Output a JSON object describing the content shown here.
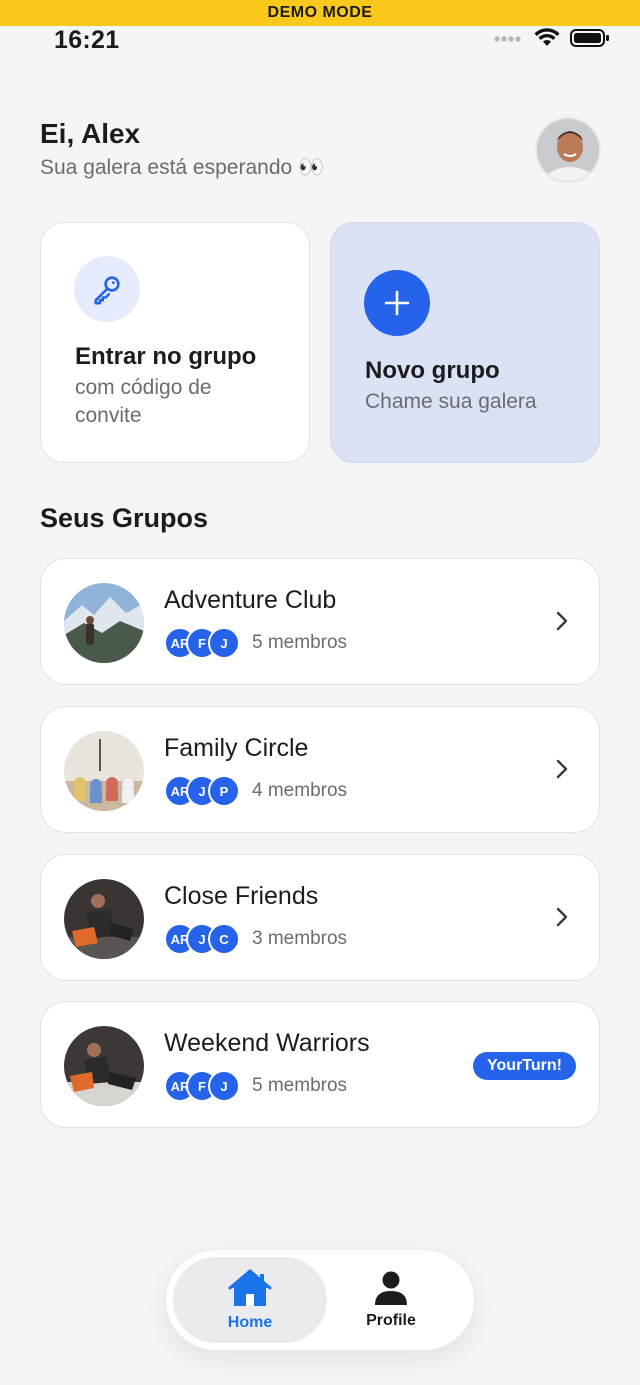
{
  "demo_banner": "DEMO MODE",
  "status_bar": {
    "time": "16:21"
  },
  "header": {
    "greeting": "Ei, Alex",
    "subtitle": "Sua galera está esperando 👀"
  },
  "actions": {
    "join": {
      "title": "Entrar no grupo",
      "subtitle_line1": "com código de",
      "subtitle_line2": "convite",
      "icon": "key-icon"
    },
    "new": {
      "title": "Novo grupo",
      "subtitle": "Chame sua galera",
      "icon": "plus-icon"
    }
  },
  "groups_section": {
    "title": "Seus Grupos"
  },
  "groups": [
    {
      "name": "Adventure Club",
      "members": [
        "AR",
        "F",
        "J"
      ],
      "count_label": "5 membros",
      "trailing": "chevron"
    },
    {
      "name": "Family Circle",
      "members": [
        "AR",
        "J",
        "P"
      ],
      "count_label": "4 membros",
      "trailing": "chevron"
    },
    {
      "name": "Close Friends",
      "members": [
        "AR",
        "J",
        "C"
      ],
      "count_label": "3 membros",
      "trailing": "chevron"
    },
    {
      "name": "Weekend Warriors",
      "members": [
        "AR",
        "F",
        "J"
      ],
      "count_label": "5 membros",
      "trailing": "badge",
      "badge": "YourTurn!"
    }
  ],
  "tabbar": {
    "home": {
      "label": "Home",
      "icon": "house-icon",
      "selected": true
    },
    "profile": {
      "label": "Profile",
      "icon": "person-icon",
      "selected": false
    }
  },
  "colors": {
    "accent": "#2563eb",
    "banner": "#f9c81b",
    "background": "#f5f5f5",
    "new_card": "#dbe2f5"
  }
}
